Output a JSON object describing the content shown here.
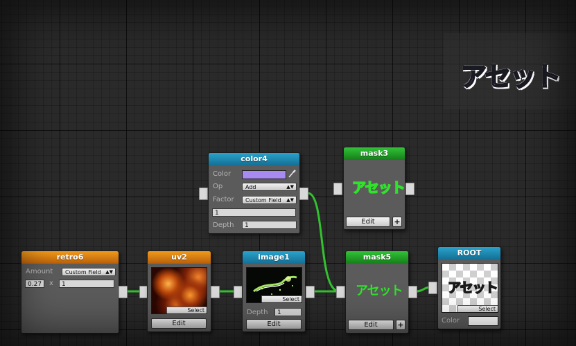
{
  "preview": {
    "art_text": "アセット"
  },
  "nodes": {
    "retro6": {
      "title": "retro6",
      "amount_label": "Amount",
      "amount_mode": "Custom Field",
      "value_a": "0.27",
      "times": "x",
      "value_b": "1"
    },
    "uv2": {
      "title": "uv2",
      "select_label": "Select",
      "edit_label": "Edit"
    },
    "color4": {
      "title": "color4",
      "color_label": "Color",
      "color_value": "#a78bf0",
      "op_label": "Op",
      "op_value": "Add",
      "factor_label": "Factor",
      "factor_value": "Custom Field",
      "factor_field": "1",
      "depth_label": "Depth",
      "depth_value": "1"
    },
    "image1": {
      "title": "image1",
      "select_label": "Select",
      "depth_label": "Depth",
      "depth_value": "1",
      "edit_label": "Edit"
    },
    "mask3": {
      "title": "mask3",
      "art_text": "アセット",
      "edit_label": "Edit",
      "plus_label": "+"
    },
    "mask5": {
      "title": "mask5",
      "art_text": "アセット",
      "edit_label": "Edit",
      "plus_label": "+"
    },
    "root": {
      "title": "ROOT",
      "art_text": "アセット",
      "select_label": "Select",
      "color_label": "Color",
      "color_value": "#ffffff"
    }
  },
  "colors": {
    "header_orange": "#e38a17",
    "header_blue": "#1d8ab3",
    "header_green": "#23a128",
    "wire_green": "#33c12f"
  },
  "icons": [
    "eyedropper-icon",
    "dropdown-arrow-icon"
  ]
}
